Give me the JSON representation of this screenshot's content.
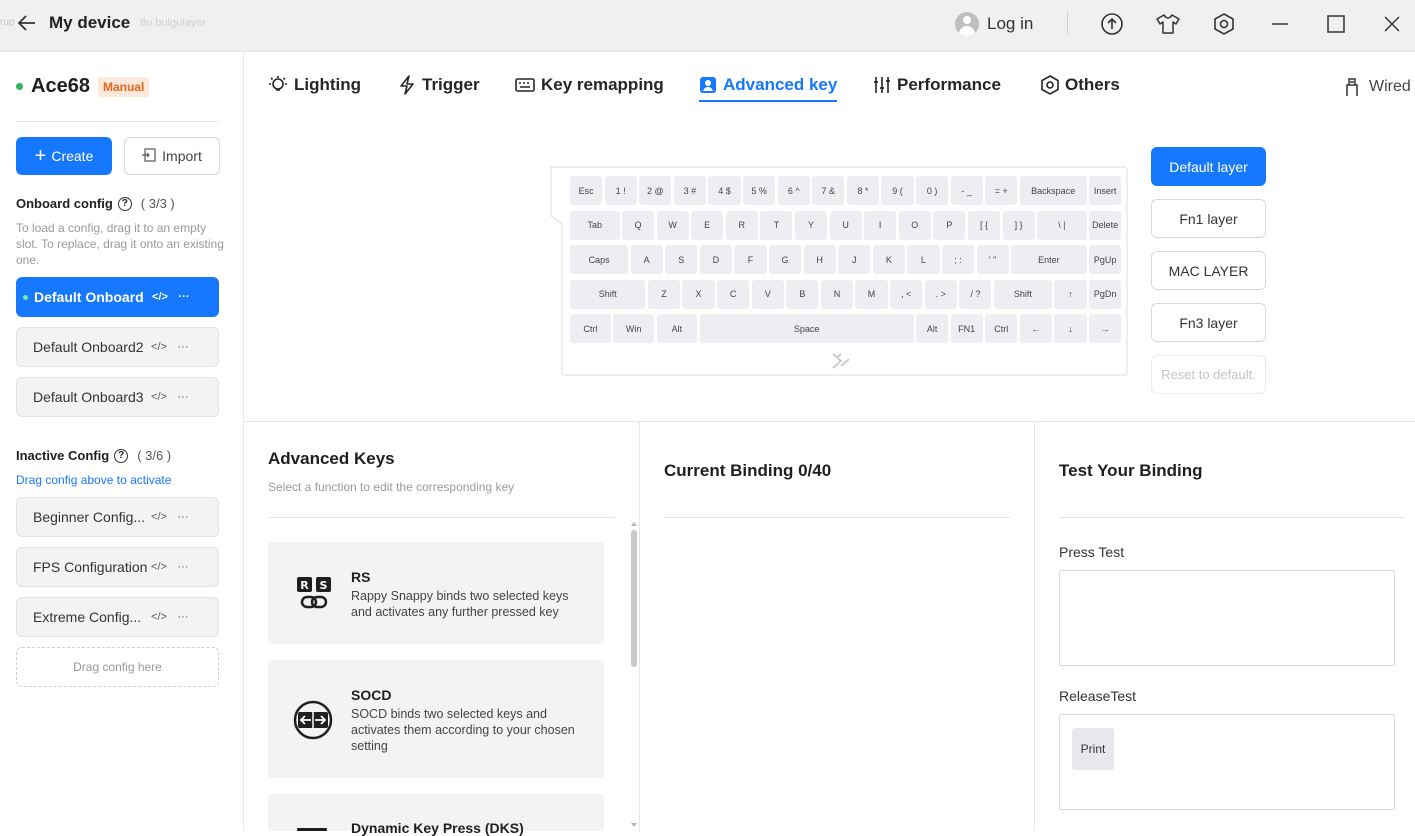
{
  "topbar": {
    "title": "My device",
    "login": "Log in",
    "ghost_left": "rup",
    "ghost_right": "8u bulgulayer"
  },
  "device": {
    "name": "Ace68",
    "mode_badge": "Manual"
  },
  "actions": {
    "create": "Create",
    "import": "Import"
  },
  "onboard": {
    "title": "Onboard config",
    "count": "( 3/3 )",
    "hint": "To load a config, drag it to an empty slot. To replace, drag it onto an existing one.",
    "items": [
      {
        "label": "Default Onboard",
        "active": true
      },
      {
        "label": "Default Onboard2"
      },
      {
        "label": "Default Onboard3"
      }
    ]
  },
  "inactive": {
    "title": "Inactive Config",
    "count": "( 3/6 )",
    "hint": "Drag config above to activate",
    "items": [
      {
        "label": "Beginner Config..."
      },
      {
        "label": "FPS Configuration"
      },
      {
        "label": "Extreme Config..."
      }
    ],
    "drop_label": "Drag config here"
  },
  "tabs": [
    {
      "label": "Lighting",
      "icon": "bulb-icon"
    },
    {
      "label": "Trigger",
      "icon": "bolt-icon"
    },
    {
      "label": "Key remapping",
      "icon": "keyboard-icon"
    },
    {
      "label": "Advanced key",
      "icon": "user-key-icon",
      "active": true
    },
    {
      "label": "Performance",
      "icon": "sliders-icon"
    },
    {
      "label": "Others",
      "icon": "hexagon-icon"
    }
  ],
  "connection": "Wired",
  "keyboard": {
    "rows": [
      [
        "Esc",
        "1 !",
        "2 @",
        "3 #",
        "4 $",
        "5 %",
        "6 ^",
        "7 &",
        "8 *",
        "9 (",
        "0 )",
        "- _",
        "= +",
        "Backspace",
        "Insert"
      ],
      [
        "Tab",
        "Q",
        "W",
        "E",
        "R",
        "T",
        "Y",
        "U",
        "I",
        "O",
        "P",
        "[ {",
        "] }",
        "\\ |",
        "Delete"
      ],
      [
        "Caps",
        "A",
        "S",
        "D",
        "F",
        "G",
        "H",
        "J",
        "K",
        "L",
        "; :",
        "' \"",
        "Enter",
        "PgUp"
      ],
      [
        "Shift",
        "Z",
        "X",
        "C",
        "V",
        "B",
        "N",
        "M",
        ", <",
        ". >",
        "/ ?",
        "Shift",
        "↑",
        "PgDn"
      ],
      [
        "Ctrl",
        "Win",
        "Alt",
        "Space",
        "Alt",
        "FN1",
        "Ctrl",
        "←",
        "↓",
        "→"
      ]
    ]
  },
  "layers": {
    "items": [
      "Default layer",
      "Fn1 layer",
      "MAC LAYER",
      "Fn3 layer"
    ],
    "reset": "Reset to default."
  },
  "advanced_keys": {
    "title": "Advanced Keys",
    "subtitle": "Select a function to edit the corresponding key",
    "cards": [
      {
        "title": "RS",
        "desc": "Rappy Snappy binds two selected keys and activates any further pressed key",
        "icon": "rs-icon"
      },
      {
        "title": "SOCD",
        "desc": "SOCD binds two selected keys and activates them according to your chosen setting",
        "icon": "socd-icon"
      },
      {
        "title": "Dynamic Key Press (DKS)",
        "desc": "",
        "icon": "dks-icon"
      }
    ]
  },
  "binding": {
    "title": "Current Binding 0/40"
  },
  "test": {
    "title": "Test Your Binding",
    "press_label": "Press Test",
    "release_label": "ReleaseTest",
    "release_chip": "Print"
  },
  "colors": {
    "accent": "#1677ff",
    "online": "#2db55d",
    "badge_bg": "#fde8dc",
    "badge_fg": "#e0661a"
  }
}
